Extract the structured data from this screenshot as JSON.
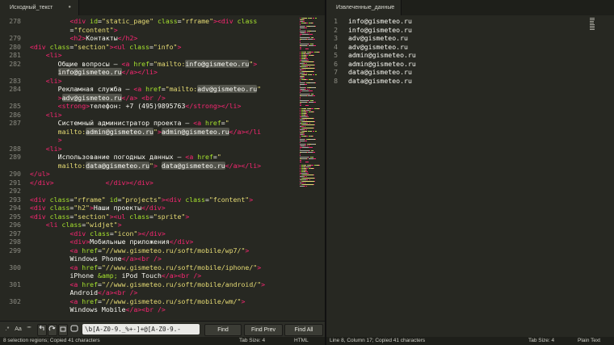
{
  "left_tab": {
    "title": "Исходный_текст",
    "close": "●"
  },
  "right_tab": {
    "title": "Извлеченные_данные",
    "close": "×"
  },
  "left_lines": [
    {
      "n": "278",
      "indent": 10,
      "segs": [
        [
          "t",
          "<div"
        ],
        [
          "p",
          " "
        ],
        [
          "a",
          "id"
        ],
        [
          "p",
          "="
        ],
        [
          "s",
          "\"static_page\""
        ],
        [
          "p",
          " "
        ],
        [
          "a",
          "class"
        ],
        [
          "p",
          "="
        ],
        [
          "s",
          "\"rframe\""
        ],
        [
          "t",
          ">"
        ],
        [
          "t",
          "<div"
        ],
        [
          "p",
          " "
        ],
        [
          "a",
          "class"
        ]
      ]
    },
    {
      "n": "",
      "indent": 10,
      "segs": [
        [
          "p",
          "="
        ],
        [
          "s",
          "\"fcontent\""
        ],
        [
          "t",
          ">"
        ]
      ]
    },
    {
      "n": "279",
      "indent": 10,
      "segs": [
        [
          "t",
          "<h2>"
        ],
        [
          "p",
          "Контакты"
        ],
        [
          "t",
          "</h2>"
        ]
      ]
    },
    {
      "n": "280",
      "indent": 0,
      "segs": [
        [
          "t",
          "<div"
        ],
        [
          "p",
          " "
        ],
        [
          "a",
          "class"
        ],
        [
          "p",
          "="
        ],
        [
          "s",
          "\"section\""
        ],
        [
          "t",
          ">"
        ],
        [
          "t",
          "<ul"
        ],
        [
          "p",
          " "
        ],
        [
          "a",
          "class"
        ],
        [
          "p",
          "="
        ],
        [
          "s",
          "\"info\""
        ],
        [
          "t",
          ">"
        ]
      ]
    },
    {
      "n": "281",
      "indent": 4,
      "segs": [
        [
          "t",
          "<li>"
        ]
      ]
    },
    {
      "n": "282",
      "indent": 7,
      "segs": [
        [
          "p",
          "Общие вопросы – "
        ],
        [
          "t",
          "<a"
        ],
        [
          "p",
          " "
        ],
        [
          "a",
          "href"
        ],
        [
          "p",
          "="
        ],
        [
          "s",
          "\"mailto:"
        ],
        [
          "hl",
          "info@gismeteo.ru"
        ],
        [
          "s",
          "\""
        ],
        [
          "t",
          ">"
        ]
      ]
    },
    {
      "n": "",
      "indent": 7,
      "segs": [
        [
          "hl",
          "info@gismeteo.ru"
        ],
        [
          "t",
          "</a></li>"
        ]
      ]
    },
    {
      "n": "283",
      "indent": 4,
      "segs": [
        [
          "t",
          "<li>"
        ]
      ]
    },
    {
      "n": "284",
      "indent": 7,
      "segs": [
        [
          "p",
          "Рекламная служба – "
        ],
        [
          "t",
          "<a"
        ],
        [
          "p",
          " "
        ],
        [
          "a",
          "href"
        ],
        [
          "p",
          "="
        ],
        [
          "s",
          "\"mailto:"
        ],
        [
          "hl",
          "adv@gismeteo.ru"
        ],
        [
          "s",
          "\""
        ]
      ]
    },
    {
      "n": "",
      "indent": 7,
      "segs": [
        [
          "t",
          ">"
        ],
        [
          "hl",
          "adv@gismeteo.ru"
        ],
        [
          "t",
          "</a>"
        ],
        [
          "p",
          " "
        ],
        [
          "t",
          "<br"
        ],
        [
          "p",
          " "
        ],
        [
          "t",
          "/>"
        ]
      ]
    },
    {
      "n": "285",
      "indent": 7,
      "segs": [
        [
          "t",
          "<strong>"
        ],
        [
          "p",
          "телефон: +7 (495)9895763"
        ],
        [
          "t",
          "</strong></li>"
        ]
      ]
    },
    {
      "n": "286",
      "indent": 4,
      "segs": [
        [
          "t",
          "<li>"
        ]
      ]
    },
    {
      "n": "287",
      "indent": 7,
      "segs": [
        [
          "p",
          "Системный администратор проекта – "
        ],
        [
          "t",
          "<a"
        ],
        [
          "p",
          " "
        ],
        [
          "a",
          "href"
        ],
        [
          "p",
          "="
        ],
        [
          "s",
          "\""
        ]
      ]
    },
    {
      "n": "",
      "indent": 7,
      "segs": [
        [
          "s",
          "mailto:"
        ],
        [
          "hl",
          "admin@gismeteo.ru"
        ],
        [
          "s",
          "\""
        ],
        [
          "t",
          ">"
        ],
        [
          "hl",
          "admin@gismeteo.ru"
        ],
        [
          "t",
          "</a></li"
        ]
      ]
    },
    {
      "n": "",
      "indent": 7,
      "segs": [
        [
          "t",
          ">"
        ]
      ]
    },
    {
      "n": "288",
      "indent": 4,
      "segs": [
        [
          "t",
          "<li>"
        ]
      ]
    },
    {
      "n": "289",
      "indent": 7,
      "segs": [
        [
          "p",
          "Использование погодных данных – "
        ],
        [
          "t",
          "<a"
        ],
        [
          "p",
          " "
        ],
        [
          "a",
          "href"
        ],
        [
          "p",
          "="
        ],
        [
          "s",
          "\""
        ]
      ]
    },
    {
      "n": "",
      "indent": 7,
      "segs": [
        [
          "s",
          "mailto:"
        ],
        [
          "hl",
          "data@gismeteo.ru"
        ],
        [
          "s",
          "\""
        ],
        [
          "t",
          ">"
        ],
        [
          "p",
          " "
        ],
        [
          "hl",
          "data@gismeteo.ru"
        ],
        [
          "t",
          "</a></li>"
        ]
      ]
    },
    {
      "n": "290",
      "indent": 0,
      "segs": [
        [
          "t",
          "</ul>"
        ]
      ]
    },
    {
      "n": "291",
      "indent": 0,
      "segs": [
        [
          "t",
          "</div>"
        ],
        [
          "p",
          "             "
        ],
        [
          "t",
          "</div></div>"
        ]
      ]
    },
    {
      "n": "292",
      "indent": 0,
      "segs": []
    },
    {
      "n": "293",
      "indent": 0,
      "segs": [
        [
          "t",
          "<div"
        ],
        [
          "p",
          " "
        ],
        [
          "a",
          "class"
        ],
        [
          "p",
          "="
        ],
        [
          "s",
          "\"rframe\""
        ],
        [
          "p",
          " "
        ],
        [
          "a",
          "id"
        ],
        [
          "p",
          "="
        ],
        [
          "s",
          "\"projects\""
        ],
        [
          "t",
          ">"
        ],
        [
          "t",
          "<div"
        ],
        [
          "p",
          " "
        ],
        [
          "a",
          "class"
        ],
        [
          "p",
          "="
        ],
        [
          "s",
          "\"fcontent\""
        ],
        [
          "t",
          ">"
        ]
      ]
    },
    {
      "n": "294",
      "indent": 0,
      "segs": [
        [
          "t",
          "<div"
        ],
        [
          "p",
          " "
        ],
        [
          "a",
          "class"
        ],
        [
          "p",
          "="
        ],
        [
          "s",
          "\"h2\""
        ],
        [
          "t",
          ">"
        ],
        [
          "p",
          "Наши проекты"
        ],
        [
          "t",
          "</div>"
        ]
      ]
    },
    {
      "n": "295",
      "indent": 0,
      "segs": [
        [
          "t",
          "<div"
        ],
        [
          "p",
          " "
        ],
        [
          "a",
          "class"
        ],
        [
          "p",
          "="
        ],
        [
          "s",
          "\"section\""
        ],
        [
          "t",
          ">"
        ],
        [
          "t",
          "<ul"
        ],
        [
          "p",
          " "
        ],
        [
          "a",
          "class"
        ],
        [
          "p",
          "="
        ],
        [
          "s",
          "\"sprite\""
        ],
        [
          "t",
          ">"
        ]
      ]
    },
    {
      "n": "296",
      "indent": 4,
      "segs": [
        [
          "t",
          "<li"
        ],
        [
          "p",
          " "
        ],
        [
          "a",
          "class"
        ],
        [
          "p",
          "="
        ],
        [
          "s",
          "\"widjet\""
        ],
        [
          "t",
          ">"
        ]
      ]
    },
    {
      "n": "297",
      "indent": 10,
      "segs": [
        [
          "t",
          "<div"
        ],
        [
          "p",
          " "
        ],
        [
          "a",
          "class"
        ],
        [
          "p",
          "="
        ],
        [
          "s",
          "\"icon\""
        ],
        [
          "t",
          "></div>"
        ]
      ]
    },
    {
      "n": "298",
      "indent": 10,
      "segs": [
        [
          "t",
          "<div>"
        ],
        [
          "p",
          "Мобильные приложения"
        ],
        [
          "t",
          "</div>"
        ]
      ]
    },
    {
      "n": "299",
      "indent": 10,
      "segs": [
        [
          "t",
          "<a"
        ],
        [
          "p",
          " "
        ],
        [
          "a",
          "href"
        ],
        [
          "p",
          "="
        ],
        [
          "s",
          "\"//www.gismeteo.ru/soft/mobile/wp7/\""
        ],
        [
          "t",
          ">"
        ]
      ]
    },
    {
      "n": "",
      "indent": 10,
      "segs": [
        [
          "p",
          "Windows Phone"
        ],
        [
          "t",
          "</a><br"
        ],
        [
          "p",
          " "
        ],
        [
          "t",
          "/>"
        ]
      ]
    },
    {
      "n": "300",
      "indent": 10,
      "segs": [
        [
          "t",
          "<a"
        ],
        [
          "p",
          " "
        ],
        [
          "a",
          "href"
        ],
        [
          "p",
          "="
        ],
        [
          "s",
          "\"//www.gismeteo.ru/soft/mobile/iphone/\""
        ],
        [
          "t",
          ">"
        ]
      ]
    },
    {
      "n": "",
      "indent": 10,
      "segs": [
        [
          "p",
          "iPhone "
        ],
        [
          "a",
          "&amp;"
        ],
        [
          "p",
          " iPod Touch"
        ],
        [
          "t",
          "</a><br"
        ],
        [
          "p",
          " "
        ],
        [
          "t",
          "/>"
        ]
      ]
    },
    {
      "n": "301",
      "indent": 10,
      "segs": [
        [
          "t",
          "<a"
        ],
        [
          "p",
          " "
        ],
        [
          "a",
          "href"
        ],
        [
          "p",
          "="
        ],
        [
          "s",
          "\"//www.gismeteo.ru/soft/mobile/android/\""
        ],
        [
          "t",
          ">"
        ]
      ]
    },
    {
      "n": "",
      "indent": 10,
      "segs": [
        [
          "p",
          "Android"
        ],
        [
          "t",
          "</a><br"
        ],
        [
          "p",
          " "
        ],
        [
          "t",
          "/>"
        ]
      ]
    },
    {
      "n": "302",
      "indent": 10,
      "segs": [
        [
          "t",
          "<a"
        ],
        [
          "p",
          " "
        ],
        [
          "a",
          "href"
        ],
        [
          "p",
          "="
        ],
        [
          "s",
          "\"//www.gismeteo.ru/soft/mobile/wm/\""
        ],
        [
          "t",
          ">"
        ]
      ]
    },
    {
      "n": "",
      "indent": 10,
      "segs": [
        [
          "p",
          "Windows Mobile"
        ],
        [
          "t",
          "</a><br"
        ],
        [
          "p",
          " "
        ],
        [
          "t",
          "/>"
        ]
      ]
    }
  ],
  "right_lines": [
    {
      "n": "1",
      "text": "info@gismeteo.ru"
    },
    {
      "n": "2",
      "text": "info@gismeteo.ru"
    },
    {
      "n": "3",
      "text": "adv@gismeteo.ru"
    },
    {
      "n": "4",
      "text": "adv@gismeteo.ru"
    },
    {
      "n": "5",
      "text": "admin@gismeteo.ru"
    },
    {
      "n": "6",
      "text": "admin@gismeteo.ru"
    },
    {
      "n": "7",
      "text": "data@gismeteo.ru"
    },
    {
      "n": "8",
      "text": "data@gismeteo.ru"
    }
  ],
  "find_bar": {
    "regex_toggle": ".*",
    "case_toggle": "Aa",
    "word_toggle": "\"\"",
    "search_value": "\\b[A-Z0-9._%+-]+@[A-Z0-9.-",
    "find": "Find",
    "find_prev": "Find Prev",
    "find_all": "Find All"
  },
  "status_left": {
    "message": "8 selection regions; Copied 41 characters",
    "tab_size": "Tab Size: 4",
    "syntax": "HTML"
  },
  "status_right": {
    "message": "Line 8, Column 17; Copied 41 characters",
    "tab_size": "Tab Size: 4",
    "syntax": "Plain Text"
  },
  "colors": {
    "background": "#272822",
    "tag": "#f92672",
    "attribute": "#a6e22e",
    "string": "#e6db74",
    "text": "#f8f8f2",
    "selection": "#53544c"
  }
}
